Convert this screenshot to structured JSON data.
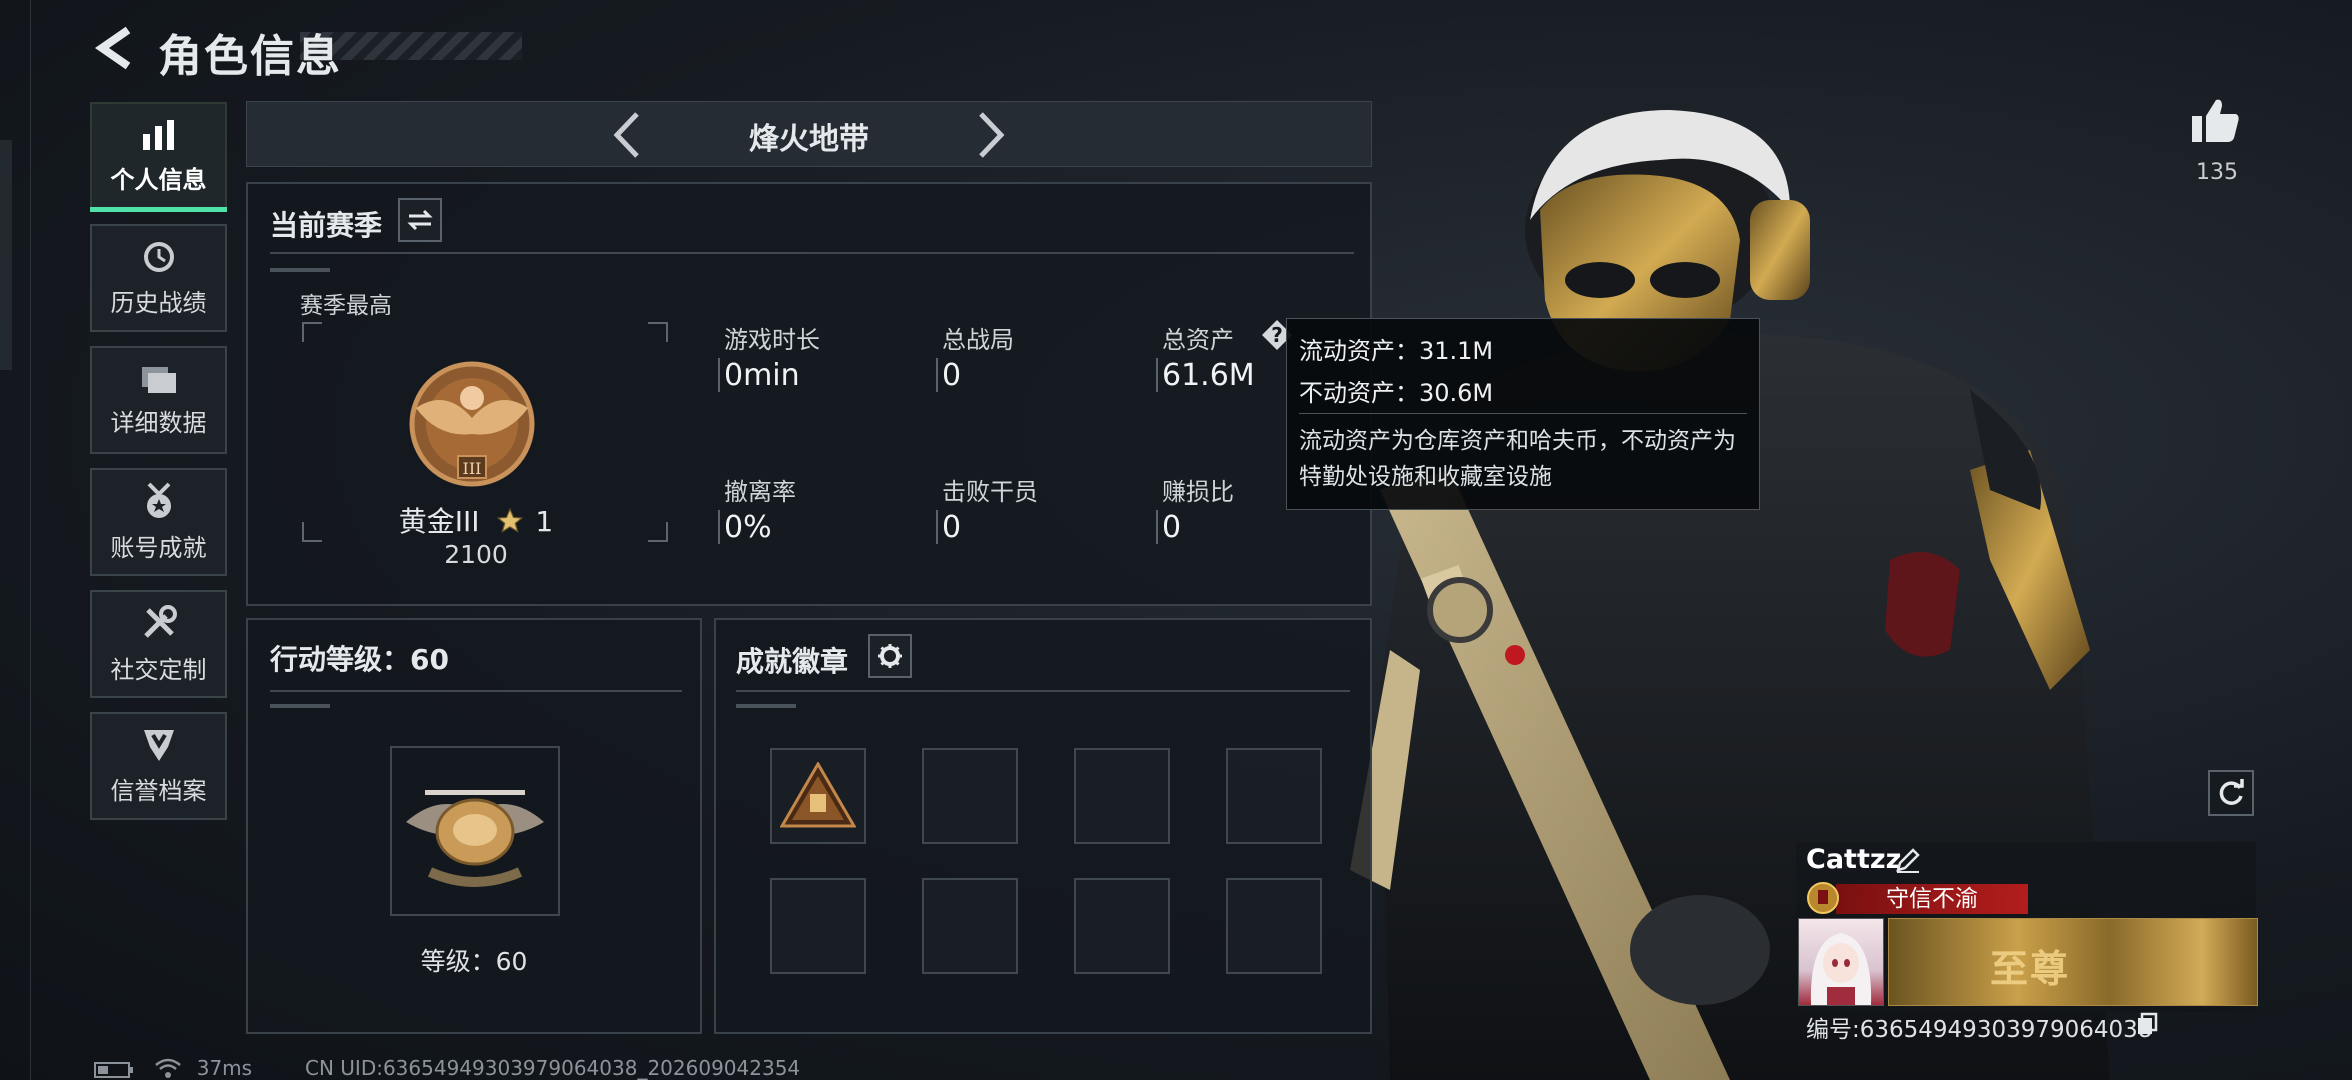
{
  "header": {
    "title": "角色信息"
  },
  "sidebar": {
    "items": [
      {
        "label": "个人信息",
        "icon": "bar-chart-icon",
        "active": true
      },
      {
        "label": "历史战绩",
        "icon": "clock-icon"
      },
      {
        "label": "详细数据",
        "icon": "folders-icon"
      },
      {
        "label": "账号成就",
        "icon": "medal-icon"
      },
      {
        "label": "社交定制",
        "icon": "tools-icon"
      },
      {
        "label": "信誉档案",
        "icon": "shield-icon"
      }
    ]
  },
  "mode": {
    "title": "烽火地带"
  },
  "season": {
    "title": "当前赛季",
    "best_label": "赛季最高",
    "rank_name": "黄金III",
    "rank_stars": "1",
    "rank_points": "2100",
    "stats": [
      {
        "label": "游戏时长",
        "value": "0min"
      },
      {
        "label": "总战局",
        "value": "0"
      },
      {
        "label": "总资产",
        "value": "61.6M"
      },
      {
        "label": "撤离率",
        "value": "0%"
      },
      {
        "label": "击败干员",
        "value": "0"
      },
      {
        "label": "赚损比",
        "value": "0"
      }
    ]
  },
  "tooltip": {
    "liquid": "流动资产：31.1M",
    "fixed": "不动资产：30.6M",
    "desc": "流动资产为仓库资产和哈夫币，不动资产为特勤处设施和收藏室设施"
  },
  "level": {
    "title": "行动等级：60",
    "label": "等级：60"
  },
  "achievements": {
    "title": "成就徽章"
  },
  "likes": {
    "count": "135"
  },
  "profile": {
    "name": "Cattzz",
    "tag": "守信不渝",
    "uid": "编号:636549493039790640​38",
    "banner_text": "至尊"
  },
  "status": {
    "ping": "37ms",
    "uid_line": "CN UID:636549493039790640​38_202609042354"
  },
  "colors": {
    "accent": "#4fe3a8",
    "tag_red": "#b31d1d",
    "gold": "#c9a24c"
  }
}
